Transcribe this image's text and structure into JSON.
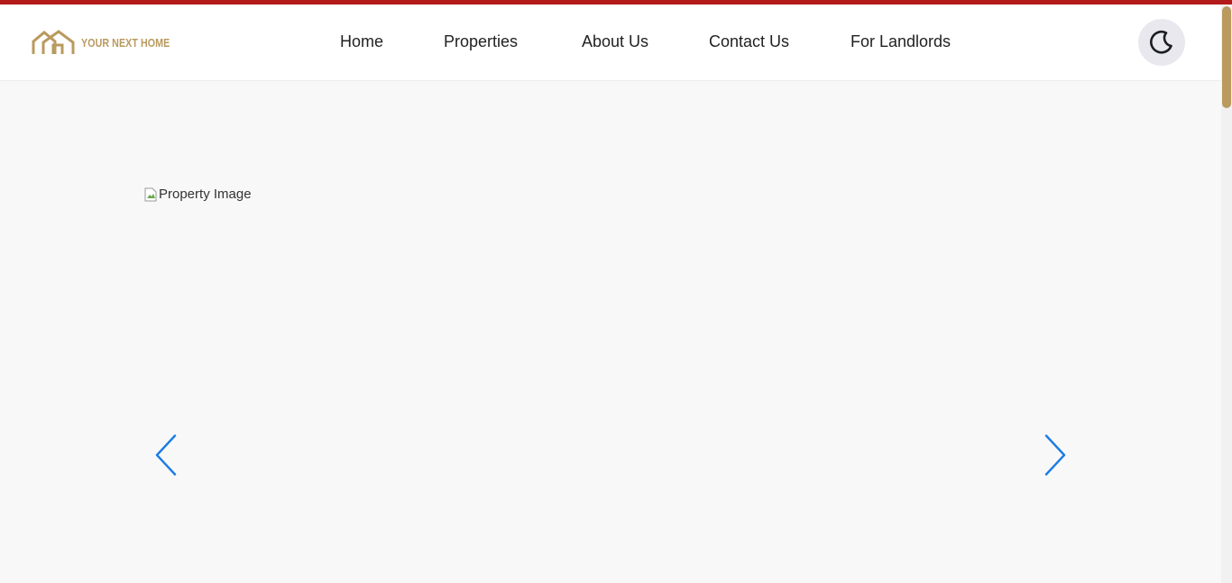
{
  "brand": {
    "name": "YOUR NEXT HOME",
    "accent_color": "#b99a5f",
    "top_bar_color": "#b31b1b"
  },
  "nav": {
    "items": [
      {
        "label": "Home"
      },
      {
        "label": "Properties"
      },
      {
        "label": "About Us"
      },
      {
        "label": "Contact Us"
      },
      {
        "label": "For Landlords"
      }
    ]
  },
  "theme_toggle": {
    "icon": "moon-icon"
  },
  "carousel": {
    "image_alt": "Property Image",
    "prev_icon": "chevron-left-icon",
    "next_icon": "chevron-right-icon",
    "arrow_color": "#1a7ce6"
  },
  "scrollbar": {
    "thumb_color": "#b99a5f"
  }
}
